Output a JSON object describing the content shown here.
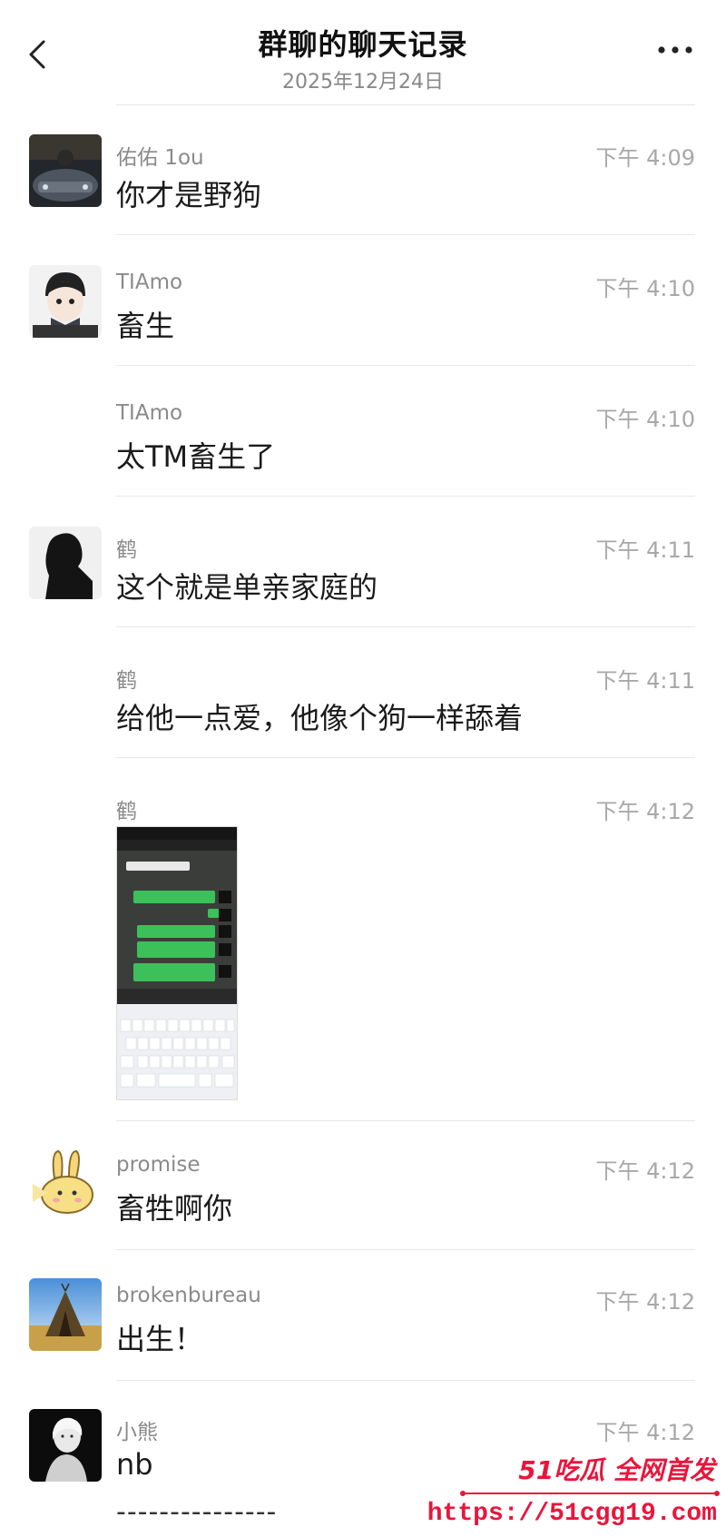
{
  "header": {
    "title": "群聊的聊天记录",
    "date": "2025年12月24日"
  },
  "messages": [
    {
      "sender": "佑佑 1ou",
      "time": "下午 4:09",
      "text": "你才是野狗"
    },
    {
      "sender": "TIAmo",
      "time": "下午 4:10",
      "text": "畜生"
    },
    {
      "sender": "TIAmo",
      "time": "下午 4:10",
      "text": "太TM畜生了"
    },
    {
      "sender": "鹤",
      "time": "下午 4:11",
      "text": "这个就是单亲家庭的"
    },
    {
      "sender": "鹤",
      "time": "下午 4:11",
      "text": "给他一点爱，他像个狗一样舔着"
    },
    {
      "sender": "鹤",
      "time": "下午 4:12",
      "text": ""
    },
    {
      "sender": "promise",
      "time": "下午 4:12",
      "text": "畜牲啊你"
    },
    {
      "sender": "brokenbureau",
      "time": "下午 4:12",
      "text": "出生！"
    },
    {
      "sender": "小熊",
      "time": "下午 4:12",
      "text": "nb"
    }
  ],
  "footer": {
    "dashes": "---------------"
  },
  "watermark": {
    "brand": "51吃瓜 全网首发",
    "url": "https://51cgg19.com"
  },
  "colors": {
    "watermark": "#e8163c",
    "accent_green": "#3cc05a"
  }
}
